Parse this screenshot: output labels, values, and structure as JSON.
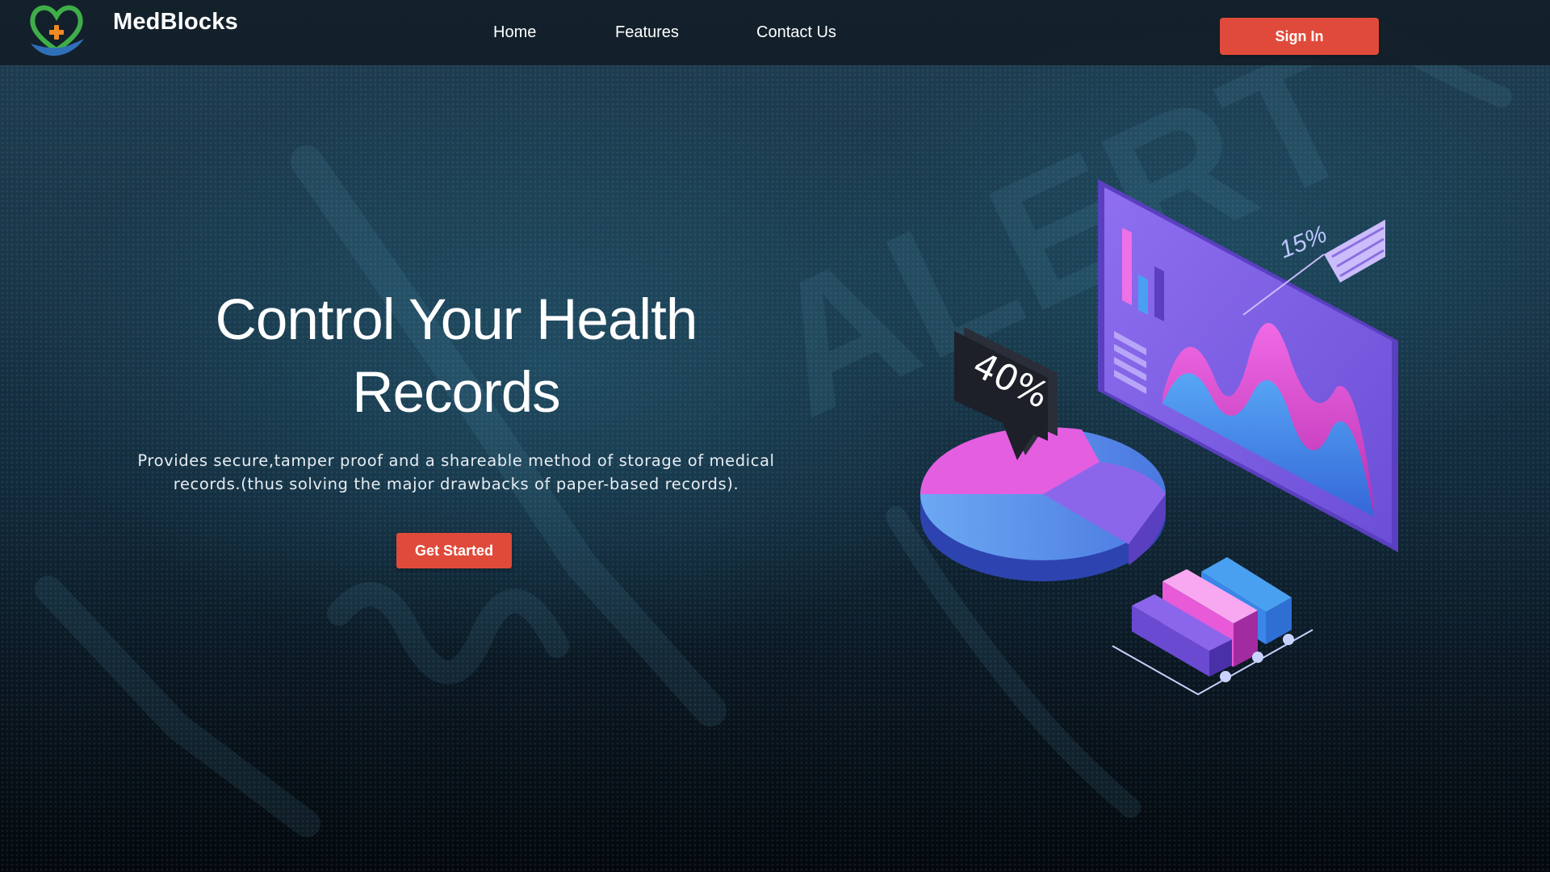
{
  "navbar": {
    "brand_name": "MedBlocks",
    "links": [
      "Home",
      "Features",
      "Contact Us"
    ],
    "signin_label": "Sign In"
  },
  "hero": {
    "title": "Control Your Health Records",
    "description": "Provides secure,tamper proof and a shareable method of storage of medical records.(thus solving the major drawbacks of paper-based records).",
    "cta_label": "Get Started"
  },
  "illustration": {
    "pie_badge": "40%",
    "monitor_badge": "15%",
    "background_word": "ALERT"
  },
  "colors": {
    "accent_button": "#e04a3a",
    "navbar_bg": "#121e28",
    "logo_green": "#3fae49",
    "logo_blue": "#2f6fb8",
    "logo_cross": "#f08a24",
    "chart_pink": "#e24ad8",
    "chart_purple": "#8b5ce8",
    "chart_blue": "#3f8ef0"
  },
  "icons": [
    "heart-hand-logo-icon"
  ]
}
